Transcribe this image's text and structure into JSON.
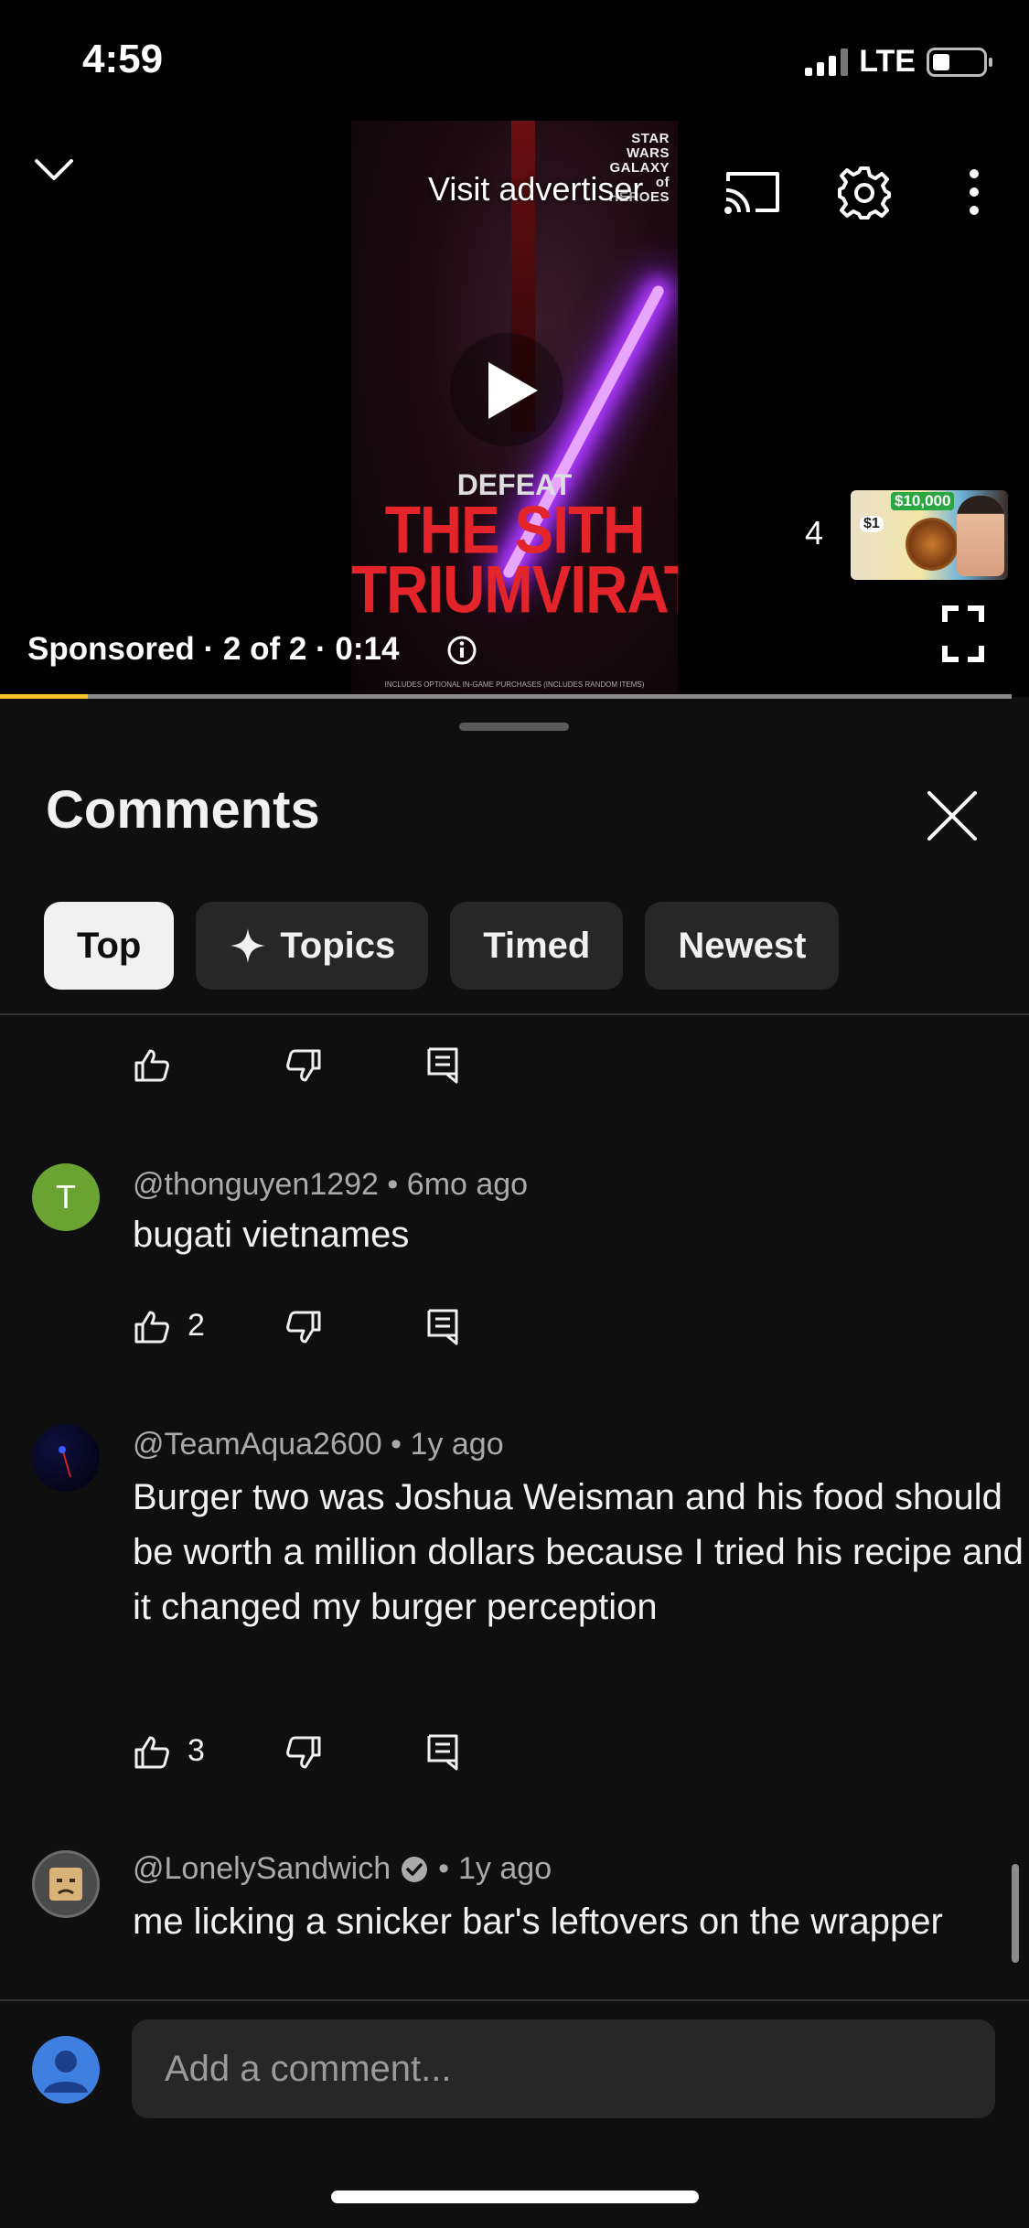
{
  "status_bar": {
    "time": "4:59",
    "network": "LTE"
  },
  "player": {
    "ad": {
      "brand": "STAR WARS GALAXY of HEROES",
      "visit_advertiser": "Visit advertiser",
      "headline_small": "DEFEAT",
      "headline_line2": "THE SITH",
      "headline_line3": "TRIUMVIRATE",
      "fine_print": "INCLUDES OPTIONAL IN-GAME PURCHASES (INCLUDES RANDOM ITEMS)"
    },
    "sponsored": "Sponsored · 2 of 2 · 0:14",
    "up_next_count": "4",
    "up_next_thumb": {
      "price_low": "$1",
      "price_high": "$10,000"
    },
    "progress": 0.087,
    "progress_color": "#f6c02b"
  },
  "comments_panel": {
    "title": "Comments",
    "chips": [
      {
        "label": "Top",
        "active": true
      },
      {
        "label": "Topics",
        "icon": "sparkle-icon"
      },
      {
        "label": "Timed"
      },
      {
        "label": "Newest"
      }
    ]
  },
  "comments": [
    {
      "author": "@thonguyen1292",
      "time": "6mo ago",
      "avatar_letter": "T",
      "text": "bugati vietnames",
      "likes": "2"
    },
    {
      "author": "@TeamAqua2600",
      "time": "1y ago",
      "text": "Burger two was Joshua Weisman and his food should be worth a million dollars because I tried his recipe and it changed my burger perception",
      "likes": "3"
    },
    {
      "author": "@LonelySandwich",
      "time": "1y ago",
      "verified": true,
      "text": "me licking a snicker bar's leftovers on the wrapper"
    }
  ],
  "composer": {
    "placeholder": "Add a comment..."
  },
  "icons": [
    "chevron-down-icon",
    "cast-icon",
    "settings-gear-icon",
    "more-vertical-icon",
    "play-icon",
    "info-icon",
    "fullscreen-icon",
    "close-icon",
    "thumbs-up-icon",
    "thumbs-down-icon",
    "reply-icon",
    "verified-icon",
    "user-avatar-icon"
  ]
}
